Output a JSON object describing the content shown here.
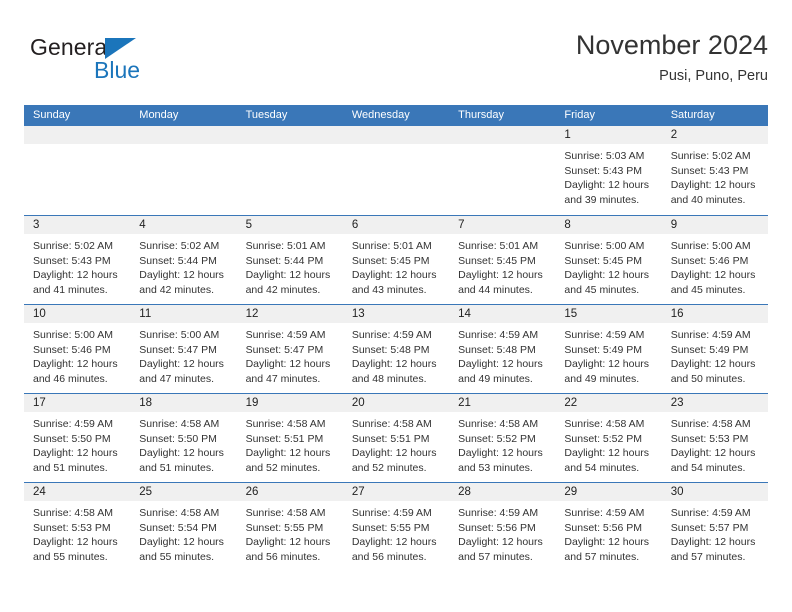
{
  "logo": {
    "word1": "General",
    "word2": "Blue",
    "triangle_color": "#1b75bb",
    "text_color": "#231f20"
  },
  "header": {
    "title": "November 2024",
    "subtitle": "Pusi, Puno, Peru"
  },
  "theme": {
    "header_bar": "#3a77b8",
    "day_strip": "#f0f0f0",
    "text": "#333333"
  },
  "weekday_headers": [
    "Sunday",
    "Monday",
    "Tuesday",
    "Wednesday",
    "Thursday",
    "Friday",
    "Saturday"
  ],
  "weeks": [
    [
      {
        "day": "",
        "lines": []
      },
      {
        "day": "",
        "lines": []
      },
      {
        "day": "",
        "lines": []
      },
      {
        "day": "",
        "lines": []
      },
      {
        "day": "",
        "lines": []
      },
      {
        "day": "1",
        "lines": [
          "Sunrise: 5:03 AM",
          "Sunset: 5:43 PM",
          "Daylight: 12 hours",
          "and 39 minutes."
        ]
      },
      {
        "day": "2",
        "lines": [
          "Sunrise: 5:02 AM",
          "Sunset: 5:43 PM",
          "Daylight: 12 hours",
          "and 40 minutes."
        ]
      }
    ],
    [
      {
        "day": "3",
        "lines": [
          "Sunrise: 5:02 AM",
          "Sunset: 5:43 PM",
          "Daylight: 12 hours",
          "and 41 minutes."
        ]
      },
      {
        "day": "4",
        "lines": [
          "Sunrise: 5:02 AM",
          "Sunset: 5:44 PM",
          "Daylight: 12 hours",
          "and 42 minutes."
        ]
      },
      {
        "day": "5",
        "lines": [
          "Sunrise: 5:01 AM",
          "Sunset: 5:44 PM",
          "Daylight: 12 hours",
          "and 42 minutes."
        ]
      },
      {
        "day": "6",
        "lines": [
          "Sunrise: 5:01 AM",
          "Sunset: 5:45 PM",
          "Daylight: 12 hours",
          "and 43 minutes."
        ]
      },
      {
        "day": "7",
        "lines": [
          "Sunrise: 5:01 AM",
          "Sunset: 5:45 PM",
          "Daylight: 12 hours",
          "and 44 minutes."
        ]
      },
      {
        "day": "8",
        "lines": [
          "Sunrise: 5:00 AM",
          "Sunset: 5:45 PM",
          "Daylight: 12 hours",
          "and 45 minutes."
        ]
      },
      {
        "day": "9",
        "lines": [
          "Sunrise: 5:00 AM",
          "Sunset: 5:46 PM",
          "Daylight: 12 hours",
          "and 45 minutes."
        ]
      }
    ],
    [
      {
        "day": "10",
        "lines": [
          "Sunrise: 5:00 AM",
          "Sunset: 5:46 PM",
          "Daylight: 12 hours",
          "and 46 minutes."
        ]
      },
      {
        "day": "11",
        "lines": [
          "Sunrise: 5:00 AM",
          "Sunset: 5:47 PM",
          "Daylight: 12 hours",
          "and 47 minutes."
        ]
      },
      {
        "day": "12",
        "lines": [
          "Sunrise: 4:59 AM",
          "Sunset: 5:47 PM",
          "Daylight: 12 hours",
          "and 47 minutes."
        ]
      },
      {
        "day": "13",
        "lines": [
          "Sunrise: 4:59 AM",
          "Sunset: 5:48 PM",
          "Daylight: 12 hours",
          "and 48 minutes."
        ]
      },
      {
        "day": "14",
        "lines": [
          "Sunrise: 4:59 AM",
          "Sunset: 5:48 PM",
          "Daylight: 12 hours",
          "and 49 minutes."
        ]
      },
      {
        "day": "15",
        "lines": [
          "Sunrise: 4:59 AM",
          "Sunset: 5:49 PM",
          "Daylight: 12 hours",
          "and 49 minutes."
        ]
      },
      {
        "day": "16",
        "lines": [
          "Sunrise: 4:59 AM",
          "Sunset: 5:49 PM",
          "Daylight: 12 hours",
          "and 50 minutes."
        ]
      }
    ],
    [
      {
        "day": "17",
        "lines": [
          "Sunrise: 4:59 AM",
          "Sunset: 5:50 PM",
          "Daylight: 12 hours",
          "and 51 minutes."
        ]
      },
      {
        "day": "18",
        "lines": [
          "Sunrise: 4:58 AM",
          "Sunset: 5:50 PM",
          "Daylight: 12 hours",
          "and 51 minutes."
        ]
      },
      {
        "day": "19",
        "lines": [
          "Sunrise: 4:58 AM",
          "Sunset: 5:51 PM",
          "Daylight: 12 hours",
          "and 52 minutes."
        ]
      },
      {
        "day": "20",
        "lines": [
          "Sunrise: 4:58 AM",
          "Sunset: 5:51 PM",
          "Daylight: 12 hours",
          "and 52 minutes."
        ]
      },
      {
        "day": "21",
        "lines": [
          "Sunrise: 4:58 AM",
          "Sunset: 5:52 PM",
          "Daylight: 12 hours",
          "and 53 minutes."
        ]
      },
      {
        "day": "22",
        "lines": [
          "Sunrise: 4:58 AM",
          "Sunset: 5:52 PM",
          "Daylight: 12 hours",
          "and 54 minutes."
        ]
      },
      {
        "day": "23",
        "lines": [
          "Sunrise: 4:58 AM",
          "Sunset: 5:53 PM",
          "Daylight: 12 hours",
          "and 54 minutes."
        ]
      }
    ],
    [
      {
        "day": "24",
        "lines": [
          "Sunrise: 4:58 AM",
          "Sunset: 5:53 PM",
          "Daylight: 12 hours",
          "and 55 minutes."
        ]
      },
      {
        "day": "25",
        "lines": [
          "Sunrise: 4:58 AM",
          "Sunset: 5:54 PM",
          "Daylight: 12 hours",
          "and 55 minutes."
        ]
      },
      {
        "day": "26",
        "lines": [
          "Sunrise: 4:58 AM",
          "Sunset: 5:55 PM",
          "Daylight: 12 hours",
          "and 56 minutes."
        ]
      },
      {
        "day": "27",
        "lines": [
          "Sunrise: 4:59 AM",
          "Sunset: 5:55 PM",
          "Daylight: 12 hours",
          "and 56 minutes."
        ]
      },
      {
        "day": "28",
        "lines": [
          "Sunrise: 4:59 AM",
          "Sunset: 5:56 PM",
          "Daylight: 12 hours",
          "and 57 minutes."
        ]
      },
      {
        "day": "29",
        "lines": [
          "Sunrise: 4:59 AM",
          "Sunset: 5:56 PM",
          "Daylight: 12 hours",
          "and 57 minutes."
        ]
      },
      {
        "day": "30",
        "lines": [
          "Sunrise: 4:59 AM",
          "Sunset: 5:57 PM",
          "Daylight: 12 hours",
          "and 57 minutes."
        ]
      }
    ]
  ]
}
